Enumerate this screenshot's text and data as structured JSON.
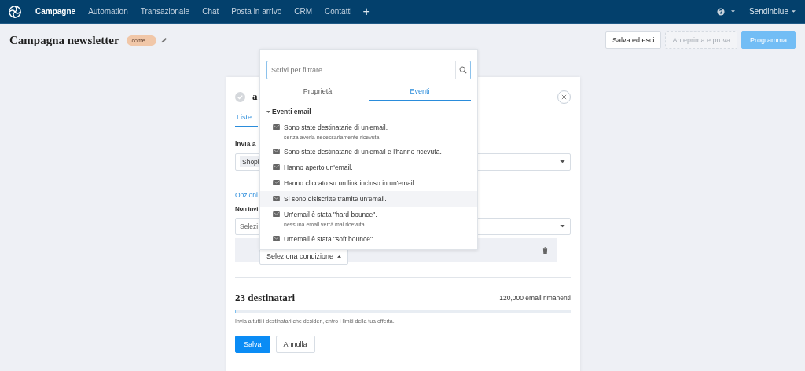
{
  "nav": {
    "items": [
      {
        "label": "Campagne",
        "selected": true
      },
      {
        "label": "Automation",
        "selected": false
      },
      {
        "label": "Transazionale",
        "selected": false
      },
      {
        "label": "Chat",
        "selected": false
      },
      {
        "label": "Posta in arrivo",
        "selected": false
      },
      {
        "label": "CRM",
        "selected": false
      },
      {
        "label": "Contatti",
        "selected": false
      }
    ],
    "add": "+",
    "account": "Sendinblue"
  },
  "header": {
    "title": "Campagna newsletter",
    "tag": "come ...",
    "buttons": [
      {
        "label": "Salva ed esci",
        "kind": "default"
      },
      {
        "label": "Anteprima e prova",
        "kind": "disabled"
      },
      {
        "label": "Programma",
        "kind": "primary"
      }
    ]
  },
  "card": {
    "title": "a",
    "tabs": [
      {
        "label": "Liste",
        "selected": true
      }
    ],
    "send_to": {
      "label": "Invia a",
      "chip": "Shopi"
    },
    "options_link": "Opzioni",
    "exclude": {
      "label": "Non invi",
      "placeholder": "Selezi"
    },
    "condition_button": "Seleziona condizione",
    "recipients": {
      "title": "23 destinatari",
      "remaining": "120,000 email rimanenti",
      "level": 0.003,
      "note": "Invia a tutti i destinatari che desideri, entro i limiti della tua offerta."
    },
    "buttons": [
      {
        "label": "Salva",
        "kind": "primary"
      },
      {
        "label": "Annulla",
        "kind": "default"
      }
    ]
  },
  "dropdown": {
    "search": {
      "placeholder": "Scrivi per filtrare"
    },
    "tabs": [
      {
        "label": "Proprietà",
        "selected": false
      },
      {
        "label": "Eventi",
        "selected": true
      }
    ],
    "group": {
      "label": "Eventi email",
      "expanded": true
    },
    "items": [
      {
        "label": "Sono state destinatarie di un'email.",
        "note": "senza averla necessariamente ricevuta",
        "hovered": false
      },
      {
        "label": "Sono state destinatarie di un'email e l'hanno ricevuta.",
        "hovered": false
      },
      {
        "label": "Hanno aperto un'email.",
        "hovered": false
      },
      {
        "label": "Hanno cliccato su un link incluso in un'email.",
        "hovered": false
      },
      {
        "label": "Si sono disiscritte tramite un'email.",
        "hovered": true
      },
      {
        "label": "Un'email è stata \"hard bounce\".",
        "note": "nessuna email verrà mai ricevuta",
        "hovered": false
      },
      {
        "label": "Un'email è stata \"soft bounce\".",
        "hovered": false
      }
    ]
  }
}
